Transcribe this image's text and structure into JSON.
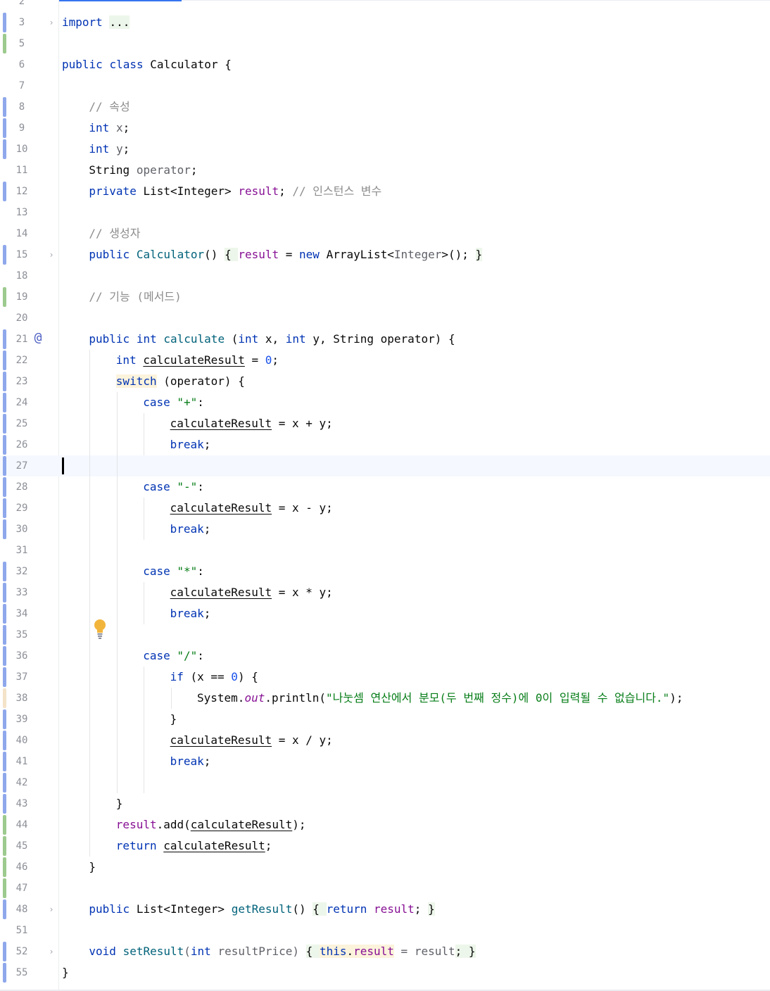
{
  "editor": {
    "file_class": "Calculator",
    "caret_line": 27,
    "lines": [
      {
        "n": "2"
      },
      {
        "n": "3",
        "code": [
          "import",
          " ",
          "..."
        ]
      },
      {
        "n": "5"
      },
      {
        "n": "6",
        "code": [
          "public",
          " ",
          "class",
          " Calculator {"
        ]
      },
      {
        "n": "7"
      },
      {
        "n": "8",
        "code": [
          "// 속성"
        ]
      },
      {
        "n": "9",
        "code": [
          "int",
          " ",
          "x",
          ";"
        ]
      },
      {
        "n": "10",
        "code": [
          "int",
          " ",
          "y",
          ";"
        ]
      },
      {
        "n": "11",
        "code": [
          "String ",
          "operator",
          ";"
        ]
      },
      {
        "n": "12",
        "code": [
          "private",
          " List<Integer> ",
          "result",
          "; ",
          "// 인스턴스 변수"
        ]
      },
      {
        "n": "13"
      },
      {
        "n": "14",
        "code": [
          "// 생성자"
        ]
      },
      {
        "n": "15",
        "code": [
          "public",
          " ",
          "Calculator",
          "() ",
          "{ ",
          "result",
          " = ",
          "new",
          " ArrayList<",
          "Integer",
          ">(); ",
          "}"
        ]
      },
      {
        "n": "18"
      },
      {
        "n": "19",
        "code": [
          "// 기능 (메서드)"
        ]
      },
      {
        "n": "20"
      },
      {
        "n": "21",
        "code": [
          "public",
          " ",
          "int",
          " ",
          "calculate",
          " (",
          "int",
          " x, ",
          "int",
          " y, String operator) {"
        ]
      },
      {
        "n": "22",
        "code": [
          "int",
          " ",
          "calculateResult",
          " = ",
          "0",
          ";"
        ]
      },
      {
        "n": "23",
        "code": [
          "switch",
          " (operator) {"
        ]
      },
      {
        "n": "24",
        "code": [
          "case",
          " ",
          "\"+\"",
          ":"
        ]
      },
      {
        "n": "25",
        "code": [
          "calculateResult",
          " = x + y;"
        ]
      },
      {
        "n": "26",
        "code": [
          "break",
          ";"
        ]
      },
      {
        "n": "27"
      },
      {
        "n": "28",
        "code": [
          "case",
          " ",
          "\"-\"",
          ":"
        ]
      },
      {
        "n": "29",
        "code": [
          "calculateResult",
          " = x - y;"
        ]
      },
      {
        "n": "30",
        "code": [
          "break",
          ";"
        ]
      },
      {
        "n": "31"
      },
      {
        "n": "32",
        "code": [
          "case",
          " ",
          "\"*\"",
          ":"
        ]
      },
      {
        "n": "33",
        "code": [
          "calculateResult",
          " = x * y;"
        ]
      },
      {
        "n": "34",
        "code": [
          "break",
          ";"
        ]
      },
      {
        "n": "35"
      },
      {
        "n": "36",
        "code": [
          "case",
          " ",
          "\"/\"",
          ":"
        ]
      },
      {
        "n": "37",
        "code": [
          "if",
          " (x == ",
          "0",
          ") {"
        ]
      },
      {
        "n": "38",
        "code": [
          "System.",
          "out",
          ".println(",
          "\"나눗셈 연산에서 분모(두 번째 정수)에 0이 입력될 수 없습니다.\"",
          ");"
        ]
      },
      {
        "n": "39",
        "code": [
          "}"
        ]
      },
      {
        "n": "40",
        "code": [
          "calculateResult",
          " = x / y;"
        ]
      },
      {
        "n": "41",
        "code": [
          "break",
          ";"
        ]
      },
      {
        "n": "42"
      },
      {
        "n": "43",
        "code": [
          "}"
        ]
      },
      {
        "n": "44",
        "code": [
          "result",
          ".add(",
          "calculateResult",
          ");"
        ]
      },
      {
        "n": "45",
        "code": [
          "return",
          " ",
          "calculateResult",
          ";"
        ]
      },
      {
        "n": "46",
        "code": [
          "}"
        ]
      },
      {
        "n": "47"
      },
      {
        "n": "48",
        "code": [
          "public",
          " List<Integer> ",
          "getResult",
          "() ",
          "{ ",
          "return",
          " ",
          "result",
          "; ",
          "}"
        ]
      },
      {
        "n": "51"
      },
      {
        "n": "52",
        "code": [
          "void",
          " ",
          "setResult",
          "(",
          "int",
          " resultPrice) ",
          "{ ",
          "this",
          ".",
          "result",
          " = ",
          "result",
          "; ",
          "}"
        ]
      },
      {
        "n": "55",
        "code": [
          "}"
        ]
      }
    ]
  },
  "colors": {
    "keyword": "#0033b3",
    "method": "#00627a",
    "field": "#871094",
    "string": "#067d17",
    "number": "#1750eb",
    "comment": "#8c8c8c",
    "change_modified": "#8fa8ec",
    "change_added": "#9dca8e",
    "change_other": "#f4e3c9",
    "current_line": "#f5f8fe",
    "tab_accent": "#3574f0"
  },
  "icons": {
    "fold": "chevron-right-icon",
    "override": "at-sign-icon",
    "intention": "lightbulb-icon"
  }
}
